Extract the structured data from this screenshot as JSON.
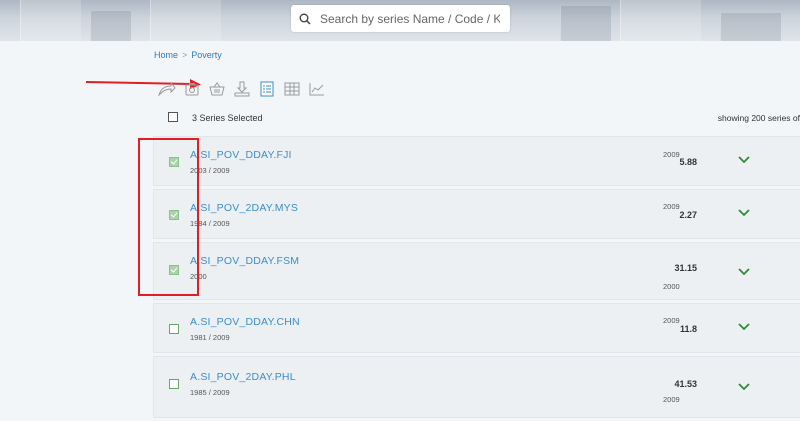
{
  "search": {
    "placeholder": "Search by series Name / Code / Keyword"
  },
  "breadcrumb": {
    "home": "Home",
    "separator": ">",
    "current": "Poverty"
  },
  "toolbar": {
    "icons": [
      "share-icon",
      "camera-icon",
      "basket-icon",
      "download-icon",
      "list-view-icon",
      "table-view-icon",
      "chart-view-icon"
    ],
    "active": "list-view-icon"
  },
  "selection": {
    "label": "3 Series Selected",
    "showing": "showing 200 series of"
  },
  "colors": {
    "link": "#3a8fc7",
    "check": "#a9d4a9",
    "chevron": "#2e8b3a",
    "annotation": "#e01e24"
  },
  "series": [
    {
      "name": "A.SI_POV_DDAY.FJI",
      "range": "2003 / 2009",
      "year_top": "2009",
      "value": "5.88",
      "year_bottom": "",
      "checked": true
    },
    {
      "name": "A.SI_POV_2DAY.MYS",
      "range": "1984 / 2009",
      "year_top": "2009",
      "value": "2.27",
      "year_bottom": "",
      "checked": true
    },
    {
      "name": "A.SI_POV_DDAY.FSM",
      "range": "2000",
      "year_top": "",
      "value": "31.15",
      "year_bottom": "2000",
      "checked": true
    },
    {
      "name": "A.SI_POV_DDAY.CHN",
      "range": "1981 / 2009",
      "year_top": "2009",
      "value": "11.8",
      "year_bottom": "",
      "checked": false
    },
    {
      "name": "A.SI_POV_2DAY.PHL",
      "range": "1985 / 2009",
      "year_top": "",
      "value": "41.53",
      "year_bottom": "2009",
      "checked": false
    }
  ]
}
